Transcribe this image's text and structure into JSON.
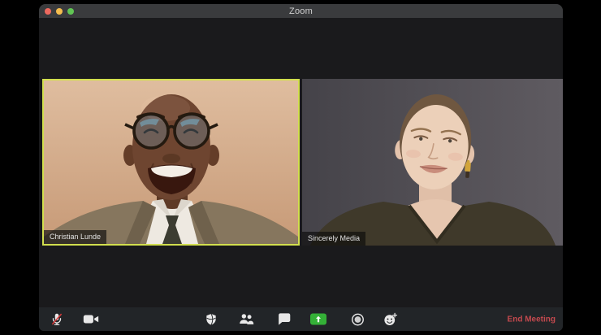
{
  "window": {
    "title": "Zoom",
    "traffic_lights": [
      "close",
      "minimize",
      "fullscreen"
    ]
  },
  "participants": [
    {
      "name": "Christian Lunde",
      "active_speaker": true,
      "description": "smiling man, round glasses, suit and tie, tan background"
    },
    {
      "name": "Sincerely Media",
      "active_speaker": false,
      "description": "woman with buzzed hair, olive v-neck top, gray background"
    }
  ],
  "toolbar": {
    "buttons": [
      {
        "id": "mute",
        "icon": "microphone-muted-icon",
        "state": "muted"
      },
      {
        "id": "video",
        "icon": "video-camera-icon",
        "state": "on"
      },
      {
        "id": "security",
        "icon": "shield-icon"
      },
      {
        "id": "participants",
        "icon": "participants-icon"
      },
      {
        "id": "chat",
        "icon": "chat-bubble-icon"
      },
      {
        "id": "share-screen",
        "icon": "share-screen-icon"
      },
      {
        "id": "record",
        "icon": "record-icon"
      },
      {
        "id": "reactions",
        "icon": "reactions-smiley-icon"
      }
    ],
    "end_meeting_label": "End Meeting"
  },
  "colors": {
    "active_speaker_border": "#d2df4e",
    "share_button_green": "#34b037",
    "end_meeting_red": "#c4494e",
    "titlebar": "#3a3b3d",
    "toolbar": "#222528",
    "content_bg": "#1a1a1c",
    "traffic_red": "#ee6a5f",
    "traffic_yellow": "#f5bd4e",
    "traffic_green": "#61c554"
  }
}
